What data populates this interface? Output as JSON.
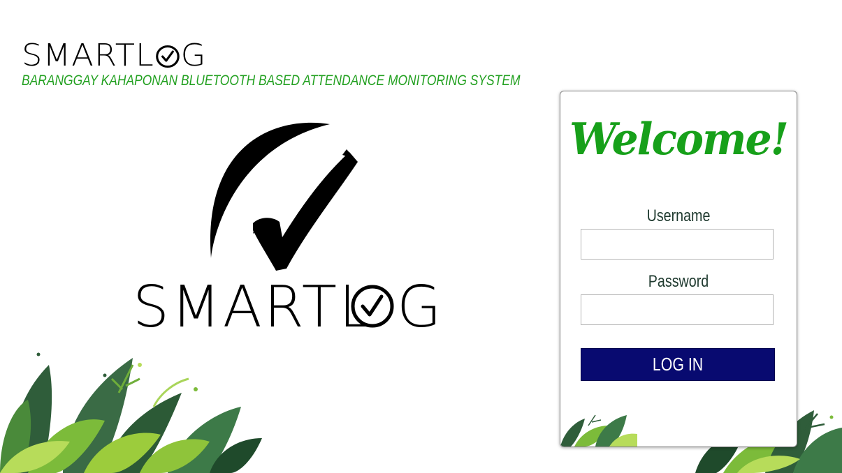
{
  "brand": {
    "title_pre": "SMARTL",
    "title_post": "G",
    "subtitle": "BARANGGAY KAHAPONAN BLUETOOTH BASED ATTENDANCE MONITORING SYSTEM"
  },
  "logo": {
    "wordmark_pre": "SMARTL",
    "wordmark_post": "G"
  },
  "login": {
    "welcome": "Welcome!",
    "username_label": "Username",
    "username_value": "",
    "password_label": "Password",
    "password_value": "",
    "button_label": "LOG IN"
  },
  "colors": {
    "accent_green": "#17a01a",
    "button_navy": "#080a70",
    "label_text": "#1f3a2f"
  },
  "icons": [
    "checkmark-logo-icon",
    "leaves-decoration"
  ]
}
